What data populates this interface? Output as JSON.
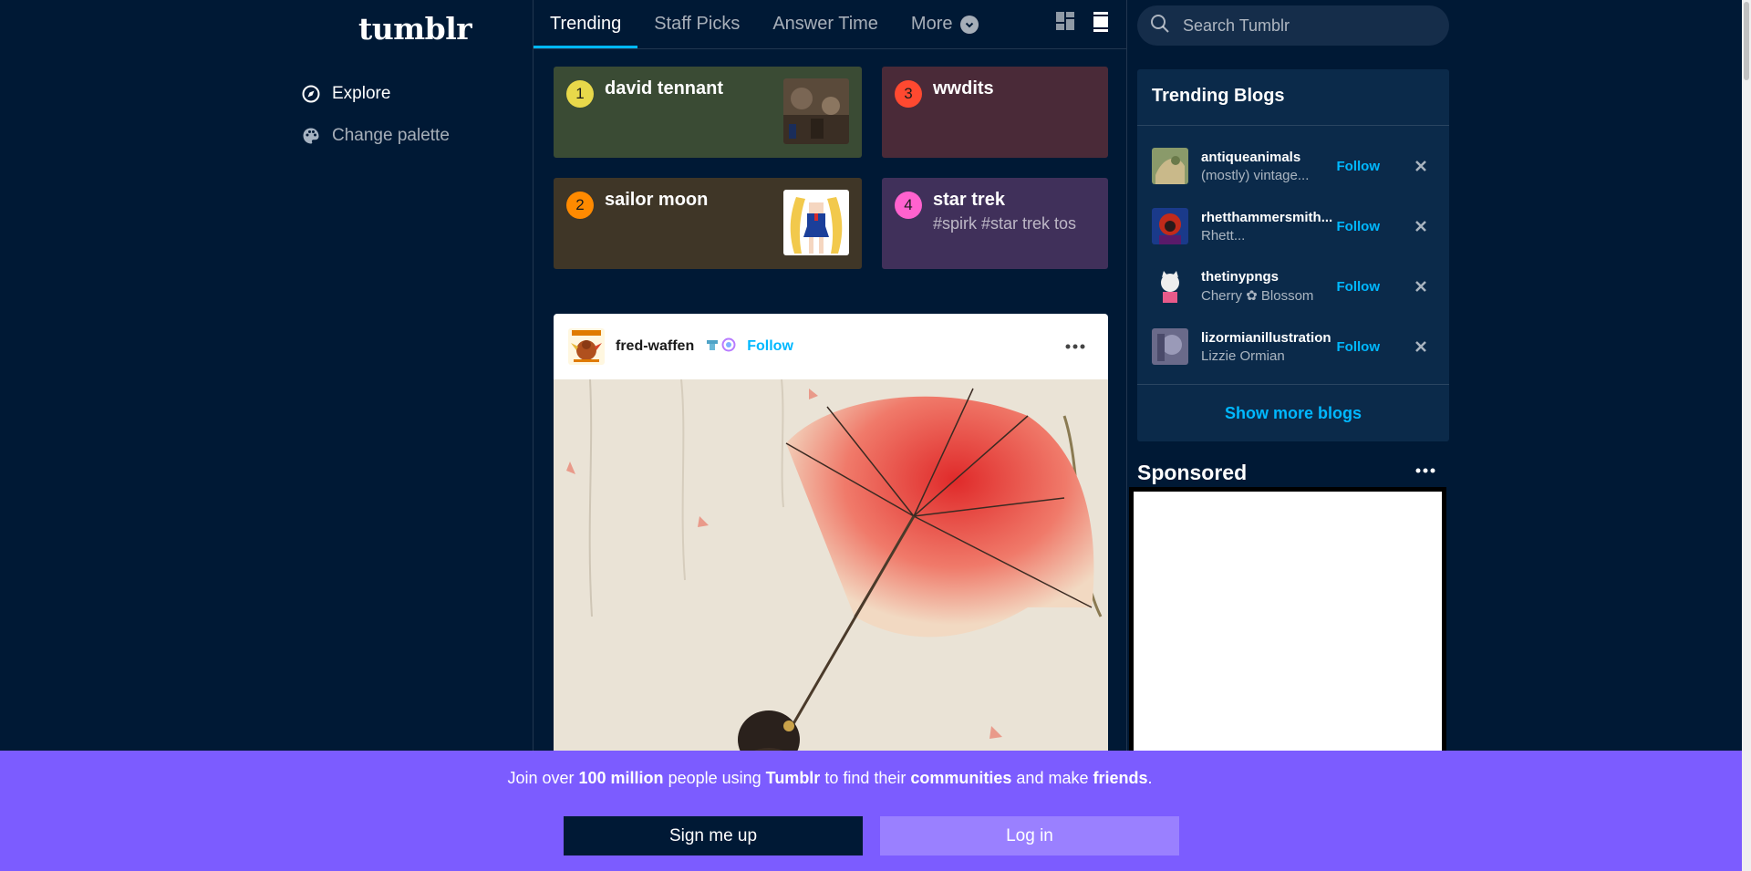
{
  "sidebar": {
    "logo": "tumblr",
    "items": [
      {
        "label": "Explore",
        "icon": "compass-icon"
      },
      {
        "label": "Change palette",
        "icon": "palette-icon"
      }
    ]
  },
  "tabs": [
    {
      "label": "Trending"
    },
    {
      "label": "Staff Picks"
    },
    {
      "label": "Answer Time"
    },
    {
      "label": "More"
    }
  ],
  "trending": [
    {
      "rank": "1",
      "title": "david tennant",
      "subtitle": "",
      "color": "#3a4b34",
      "badge_color": "#e8d84a"
    },
    {
      "rank": "3",
      "title": "wwdits",
      "subtitle": "",
      "color": "#4a2a38",
      "badge_color": "#ff4930"
    },
    {
      "rank": "2",
      "title": "sailor moon",
      "subtitle": "",
      "color": "#3f3627",
      "badge_color": "#ff8a00"
    },
    {
      "rank": "4",
      "title": "star trek",
      "subtitle": "#spirk #star trek tos",
      "color": "#40305a",
      "badge_color": "#ff62ce"
    }
  ],
  "post": {
    "blog_name": "fred-waffen",
    "follow_label": "Follow"
  },
  "search": {
    "placeholder": "Search Tumblr"
  },
  "trending_blogs": {
    "title": "Trending Blogs",
    "blogs": [
      {
        "name": "antiqueanimals",
        "desc": "(mostly) vintage..."
      },
      {
        "name": "rhetthammersmith...",
        "desc": "Rhett..."
      },
      {
        "name": "thetinypngs",
        "desc": "Cherry ✿ Blossom"
      },
      {
        "name": "lizormianillustration",
        "desc": "Lizzie Ormian"
      }
    ],
    "follow_label": "Follow",
    "show_more": "Show more blogs"
  },
  "sponsored": {
    "title": "Sponsored"
  },
  "banner": {
    "t1": "Join over ",
    "t2": "100 million",
    "t3": " people using ",
    "t4": "Tumblr",
    "t5": " to find their ",
    "t6": "communities",
    "t7": " and make ",
    "t8": "friends",
    "t9": ".",
    "signup": "Sign me up",
    "login": "Log in"
  },
  "colors": {
    "background": "#001935",
    "accent": "#00b8ff",
    "banner": "#7c5cff"
  }
}
